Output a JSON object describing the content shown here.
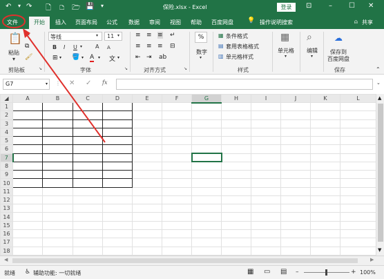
{
  "window": {
    "title": "保险.xlsx - Excel",
    "login": "登录",
    "colors": {
      "brand": "#217346",
      "annotation": "#e0302c"
    }
  },
  "tabs": {
    "file": "文件",
    "home": "开始",
    "insert": "插入",
    "page_layout": "页面布局",
    "formulas": "公式",
    "data": "数据",
    "review": "审阅",
    "view": "视图",
    "help": "帮助",
    "baidu": "百度网盘",
    "tell_me": "操作说明搜索",
    "share": "共享"
  },
  "ribbon": {
    "paste": "粘贴",
    "clipboard": "剪贴板",
    "font_name": "等线",
    "font_size": "11",
    "bold": "B",
    "italic": "I",
    "underline": "U",
    "grow": "A",
    "shrink": "A",
    "font_group": "字体",
    "align_group": "对齐方式",
    "number": "数字",
    "cond_format": "条件格式",
    "table_format": "套用表格格式",
    "cell_style": "单元格样式",
    "styles_group": "样式",
    "cells": "单元格",
    "editing": "编辑",
    "save_to_baidu": "保存到",
    "save_to_baidu2": "百度网盘",
    "save_group": "保存"
  },
  "formula_bar": {
    "name_box": "G7",
    "fx": "fx"
  },
  "grid": {
    "columns": [
      "A",
      "B",
      "C",
      "D",
      "E",
      "F",
      "G",
      "H",
      "I",
      "J",
      "K",
      "L"
    ],
    "rows": [
      "1",
      "2",
      "3",
      "4",
      "5",
      "6",
      "7",
      "8",
      "9",
      "10",
      "11",
      "12",
      "13",
      "14",
      "15",
      "16",
      "17",
      "18"
    ],
    "selected_cell": "G7"
  },
  "status": {
    "ready": "就绪",
    "accessibility": "辅助功能: 一切就绪",
    "zoom": "100%"
  }
}
